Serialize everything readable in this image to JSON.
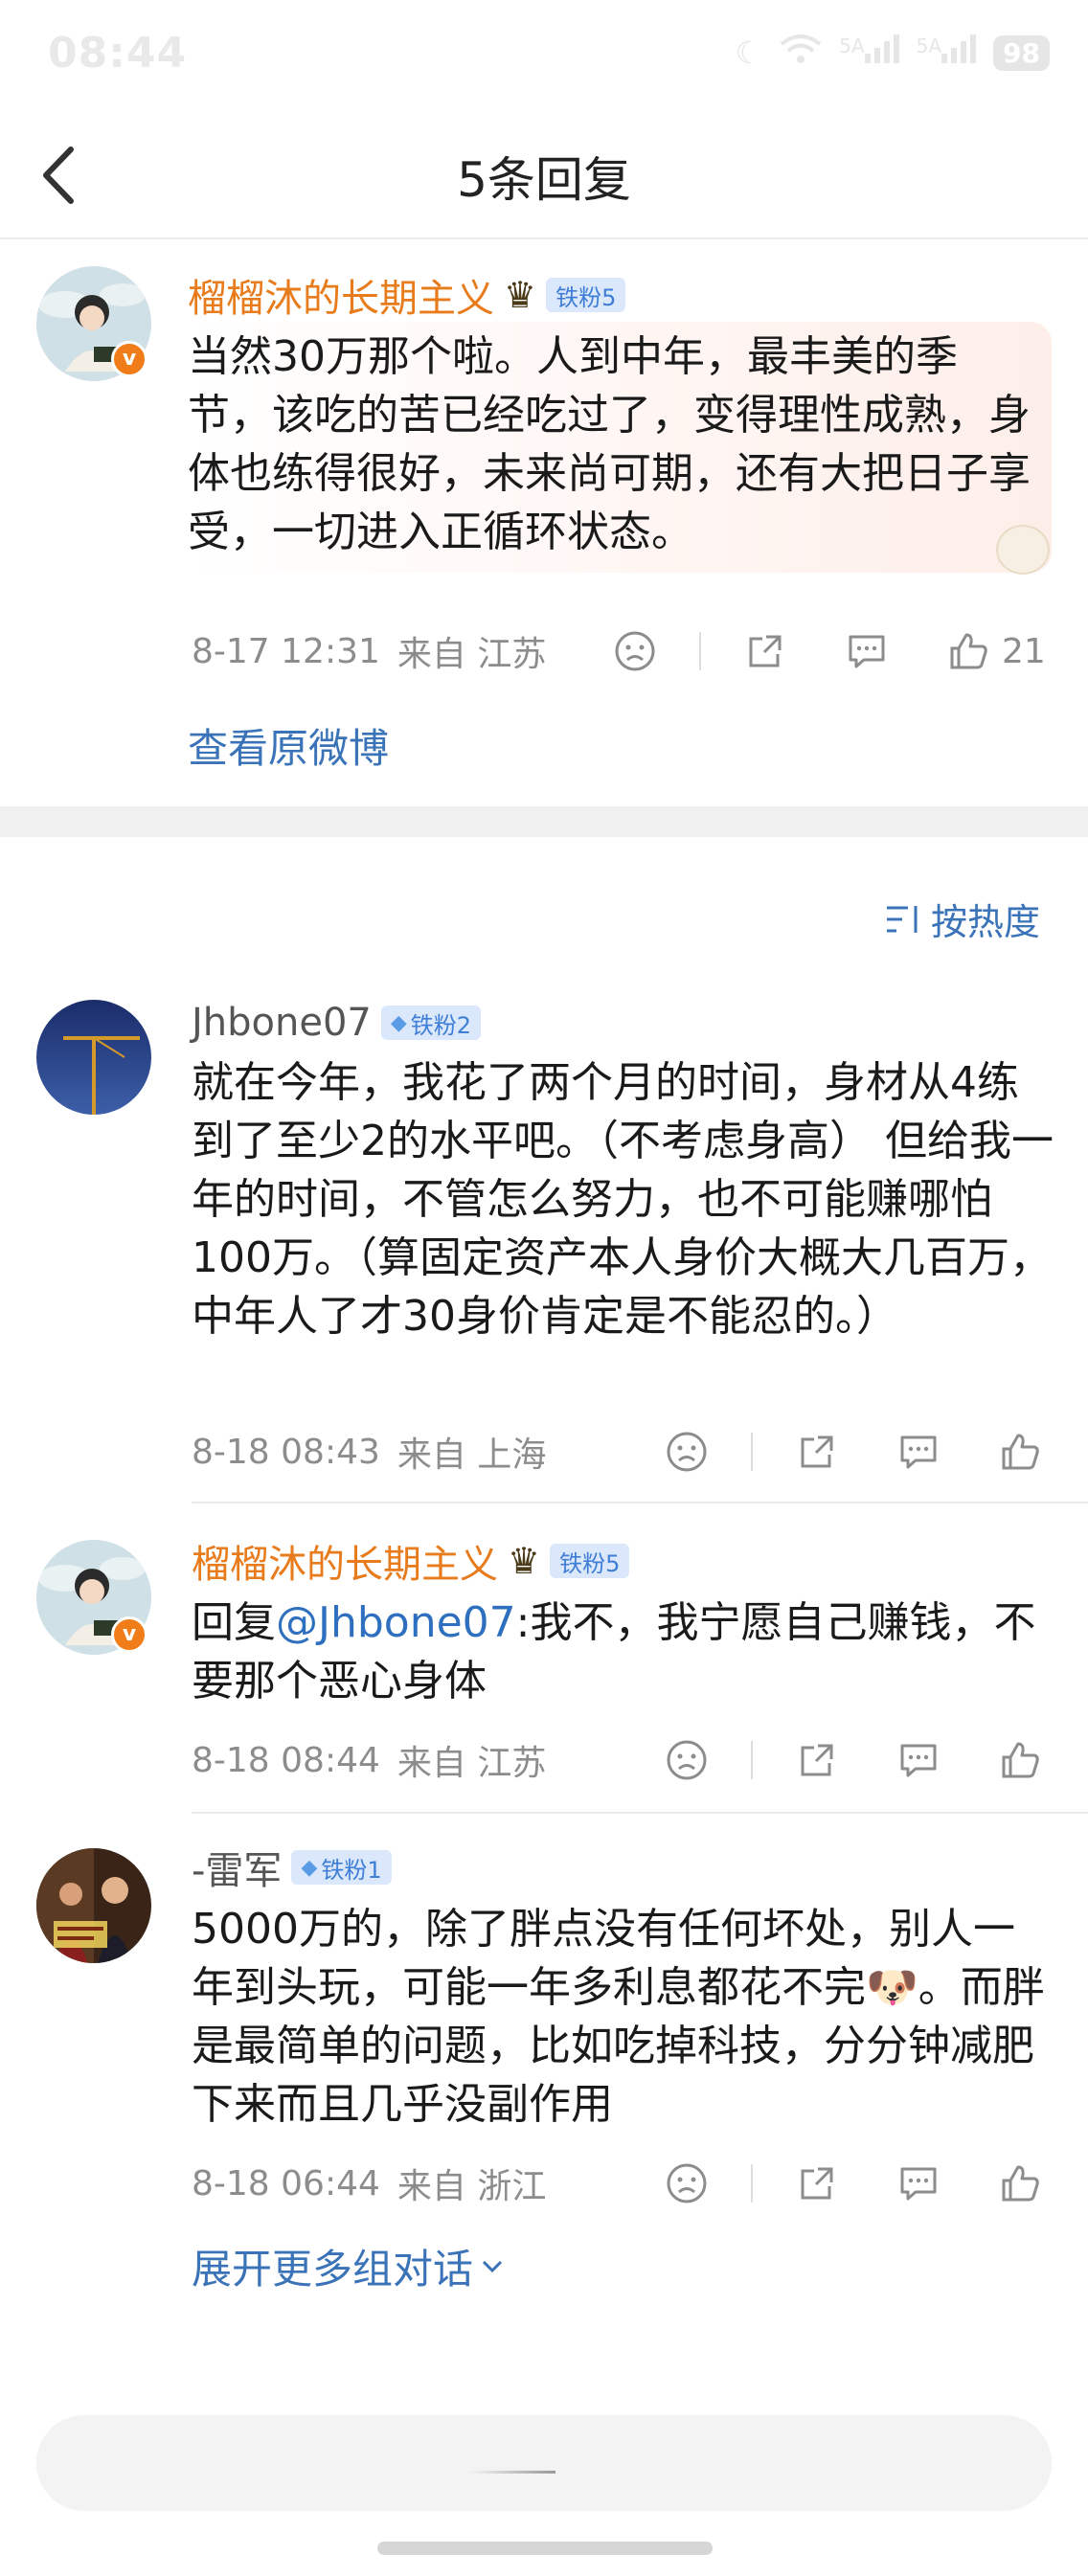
{
  "status": {
    "time": "08:44",
    "signal1": "5A",
    "signal2": "5A",
    "battery": "98"
  },
  "header": {
    "title": "5条回复"
  },
  "root": {
    "name": "榴榴沐的长期主义",
    "badge": "铁粉5",
    "v_mark": "v",
    "text": "当然30万那个啦。人到中年，最丰美的季节，该吃的苦已经吃过了，变得理性成熟，身体也练得很好，未来尚可期，还有大把日子享受，一切进入正循环状态。",
    "time": "8-17 12:31",
    "location": "来自 江苏",
    "likes": "21",
    "view_original": "查看原微博"
  },
  "sort_label": "按热度",
  "replies": [
    {
      "name": "Jhbone07",
      "badge": "铁粉2",
      "text": "就在今年，我花了两个月的时间，身材从4练到了至少2的水平吧。（不考虑身高） 但给我一年的时间，不管怎么努力，也不可能赚哪怕100万。（算固定资产本人身价大概大几百万，中年人了才30身价肯定是不能忍的。）",
      "time": "8-18 08:43",
      "location": "来自 上海"
    },
    {
      "name": "榴榴沐的长期主义",
      "badge": "铁粉5",
      "v_mark": "v",
      "reply_prefix": "回复",
      "mention": "@Jhbone07",
      "text": ":我不，我宁愿自己赚钱，不要那个恶心身体",
      "time": "8-18 08:44",
      "location": "来自 江苏"
    },
    {
      "name": "-雷军",
      "badge": "铁粉1",
      "text_a": "5000万的，除了胖点没有任何坏处，别人一年到头玩，可能一年多利息都花不完",
      "emoji": "🐶",
      "text_b": "。而胖是最简单的问题，比如吃掉科技，分分钟减肥下来而且几乎没副作用",
      "time": "8-18 06:44",
      "location": "来自 浙江"
    }
  ],
  "expand_more": "展开更多组对话",
  "colors": {
    "accent_blue": "#3b73b8",
    "name_orange": "#e87b1c",
    "badge_bg": "#dbe8fb",
    "vip_orange": "#f07d1a"
  }
}
